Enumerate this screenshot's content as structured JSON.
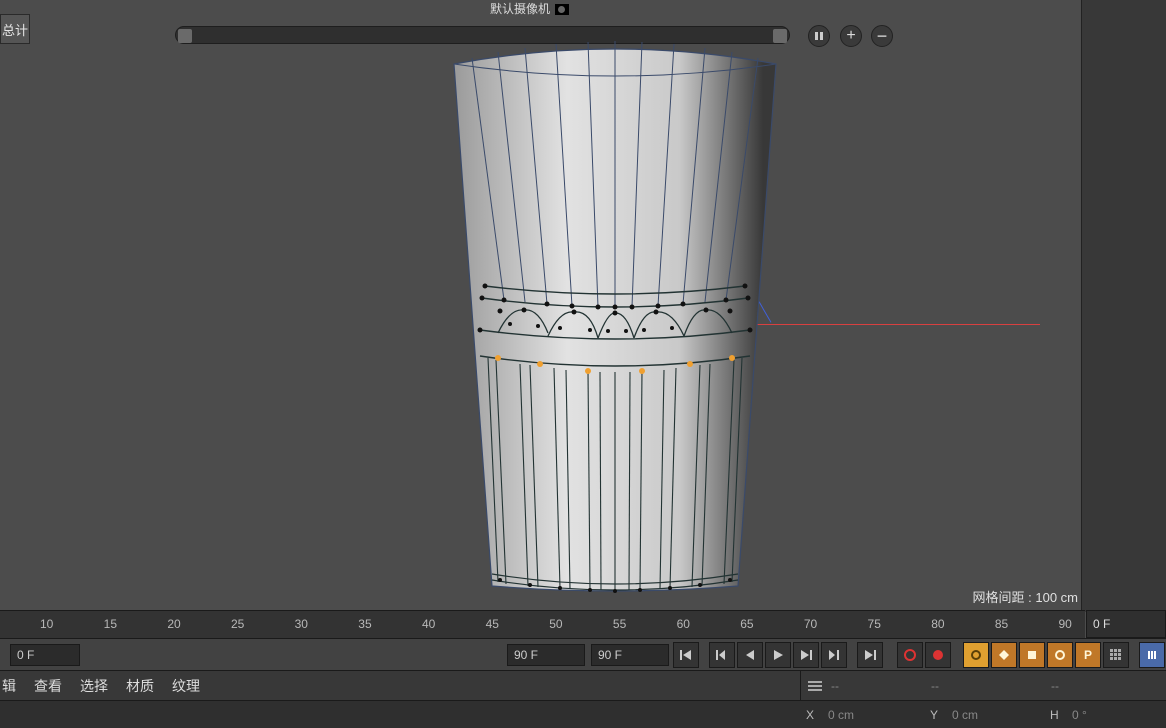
{
  "total_label": "总计",
  "camera_label": "默认摄像机",
  "pause_icon": "꤀",
  "plus_icon": "+",
  "minus_icon": "−",
  "grid_spacing_label": "网格间距 : 100 cm",
  "ruler": {
    "ticks": [
      10,
      15,
      20,
      25,
      30,
      35,
      40,
      45,
      50,
      55,
      60,
      65,
      70,
      75,
      80,
      85,
      90
    ]
  },
  "frame_readout": "0 F",
  "playback": {
    "start_frame": "0 F",
    "end_frame": "90 F",
    "current_frame": "90 F"
  },
  "menu": {
    "items": [
      "辑",
      "查看",
      "选择",
      "材质",
      "纹理"
    ]
  },
  "info": {
    "dash1": "--",
    "dash2": "--",
    "dash3": "--"
  },
  "status": {
    "x_label": "X",
    "x_value": "0 cm",
    "y_label": "Y",
    "y_value": "0 cm",
    "h_label": "H",
    "h_value": "0 °"
  }
}
